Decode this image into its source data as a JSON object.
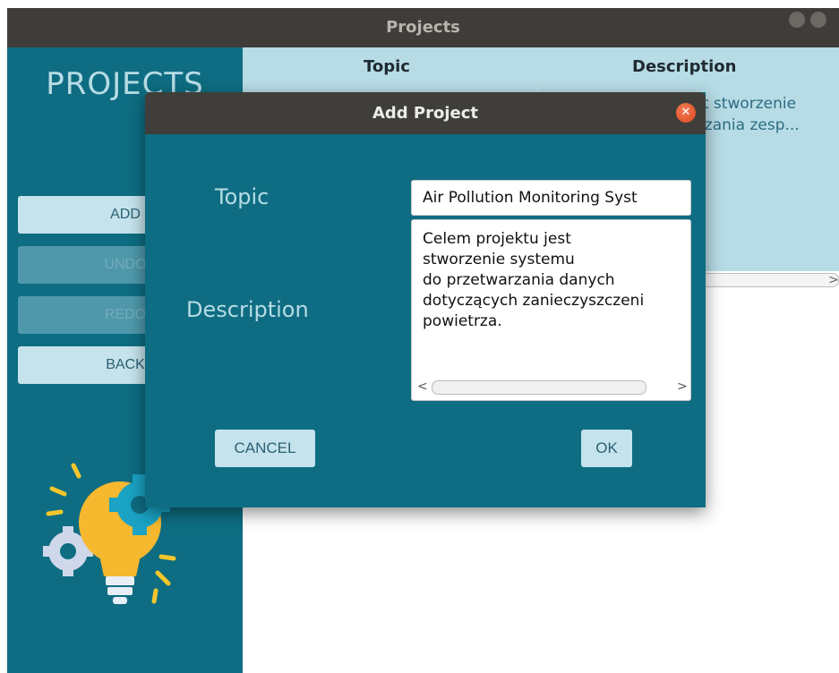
{
  "window": {
    "title": "Projects"
  },
  "sidebar": {
    "title": "PROJECTS",
    "buttons": [
      {
        "label": "ADD",
        "state": "enabled"
      },
      {
        "label": "UNDO",
        "state": "disabled"
      },
      {
        "label": "REDO",
        "state": "disabled"
      },
      {
        "label": "BACK",
        "state": "enabled"
      }
    ],
    "logo_icon": "lightbulb-gear-icon"
  },
  "table": {
    "columns": [
      "Topic",
      "Description"
    ],
    "rows": [
      {
        "description_visible": "st stworzenie\ndzania zesp..."
      }
    ]
  },
  "dialog": {
    "title": "Add Project",
    "topic_label": "Topic",
    "description_label": "Description",
    "topic_value": "Air Pollution Monitoring Syst",
    "description_value": "Celem projektu jest\nstworzenie systemu\ndo przetwarzania danych\ndotyczących zanieczyszczeni\npowietrza.",
    "cancel_label": "CANCEL",
    "ok_label": "OK"
  },
  "colors": {
    "sidebar": "#0e6d82",
    "accent_light": "#b7dce6",
    "titlebar": "#3f3d3a",
    "close": "#e05a2f"
  }
}
